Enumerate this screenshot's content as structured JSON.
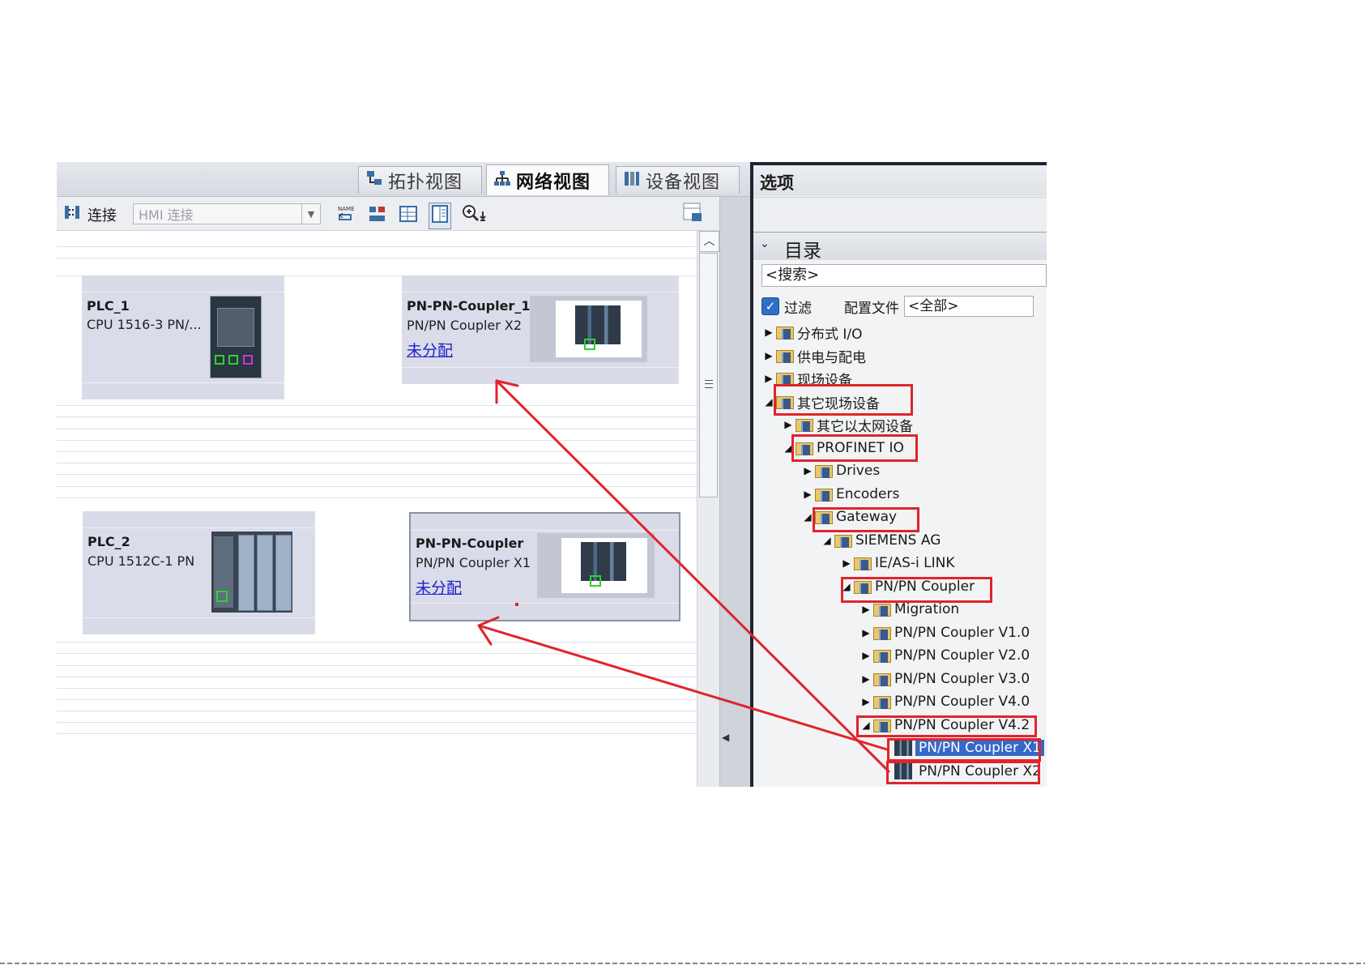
{
  "tabs": [
    {
      "label": "拓扑视图",
      "icon": "topology-view-icon",
      "active": false
    },
    {
      "label": "网络视图",
      "icon": "network-view-icon",
      "active": true
    },
    {
      "label": "设备视图",
      "icon": "device-view-icon",
      "active": false
    }
  ],
  "toolbar": {
    "connect_label": "连接",
    "connection_type": "HMI 连接"
  },
  "devices": [
    {
      "name": "PLC_1",
      "type": "CPU 1516-3 PN/...",
      "link": ""
    },
    {
      "name": "PN-PN-Coupler_1",
      "type": "PN/PN Coupler X2",
      "link": "未分配"
    },
    {
      "name": "PLC_2",
      "type": "CPU 1512C-1 PN",
      "link": ""
    },
    {
      "name": "PN-PN-Coupler",
      "type": "PN/PN Coupler X1",
      "link": "未分配"
    }
  ],
  "catalog": {
    "panel_title": "选项",
    "section_title": "目录",
    "search_placeholder": "<搜索>",
    "filter_label": "过滤",
    "filter_checked": true,
    "profile_label": "配置文件",
    "profile_value": "<全部>",
    "tree": [
      {
        "label": "分布式 I/O",
        "level": 0,
        "expanded": false,
        "kind": "folder"
      },
      {
        "label": "供电与配电",
        "level": 0,
        "expanded": false,
        "kind": "folder"
      },
      {
        "label": "现场设备",
        "level": 0,
        "expanded": false,
        "kind": "folder"
      },
      {
        "label": "其它现场设备",
        "level": 0,
        "expanded": true,
        "kind": "folder",
        "highlighted": true
      },
      {
        "label": "其它以太网设备",
        "level": 1,
        "expanded": false,
        "kind": "folder"
      },
      {
        "label": "PROFINET IO",
        "level": 1,
        "expanded": true,
        "kind": "folder",
        "highlighted": true
      },
      {
        "label": "Drives",
        "level": 2,
        "expanded": false,
        "kind": "folder"
      },
      {
        "label": "Encoders",
        "level": 2,
        "expanded": false,
        "kind": "folder"
      },
      {
        "label": "Gateway",
        "level": 2,
        "expanded": true,
        "kind": "folder",
        "highlighted": true
      },
      {
        "label": "SIEMENS AG",
        "level": 3,
        "expanded": true,
        "kind": "folder"
      },
      {
        "label": "IE/AS-i LINK",
        "level": 4,
        "expanded": false,
        "kind": "folder"
      },
      {
        "label": "PN/PN Coupler",
        "level": 4,
        "expanded": true,
        "kind": "folder",
        "highlighted": true
      },
      {
        "label": "Migration",
        "level": 5,
        "expanded": false,
        "kind": "folder"
      },
      {
        "label": "PN/PN Coupler V1.0",
        "level": 5,
        "expanded": false,
        "kind": "folder"
      },
      {
        "label": "PN/PN Coupler V2.0",
        "level": 5,
        "expanded": false,
        "kind": "folder"
      },
      {
        "label": "PN/PN Coupler V3.0",
        "level": 5,
        "expanded": false,
        "kind": "folder"
      },
      {
        "label": "PN/PN Coupler V4.0",
        "level": 5,
        "expanded": false,
        "kind": "folder"
      },
      {
        "label": "PN/PN Coupler V4.2",
        "level": 5,
        "expanded": true,
        "kind": "folder",
        "highlighted": true
      },
      {
        "label": "PN/PN Coupler X1",
        "level": 6,
        "kind": "device",
        "selected": true,
        "highlighted": true
      },
      {
        "label": "PN/PN Coupler X2",
        "level": 6,
        "kind": "device",
        "highlighted": true
      }
    ]
  },
  "colors": {
    "annotation": "#e0242b",
    "selection": "#3569c8",
    "device_box": "#d9dce8",
    "link_text": "#2020c8",
    "port_green": "#2fd12f",
    "port_magenta": "#c436d6"
  }
}
